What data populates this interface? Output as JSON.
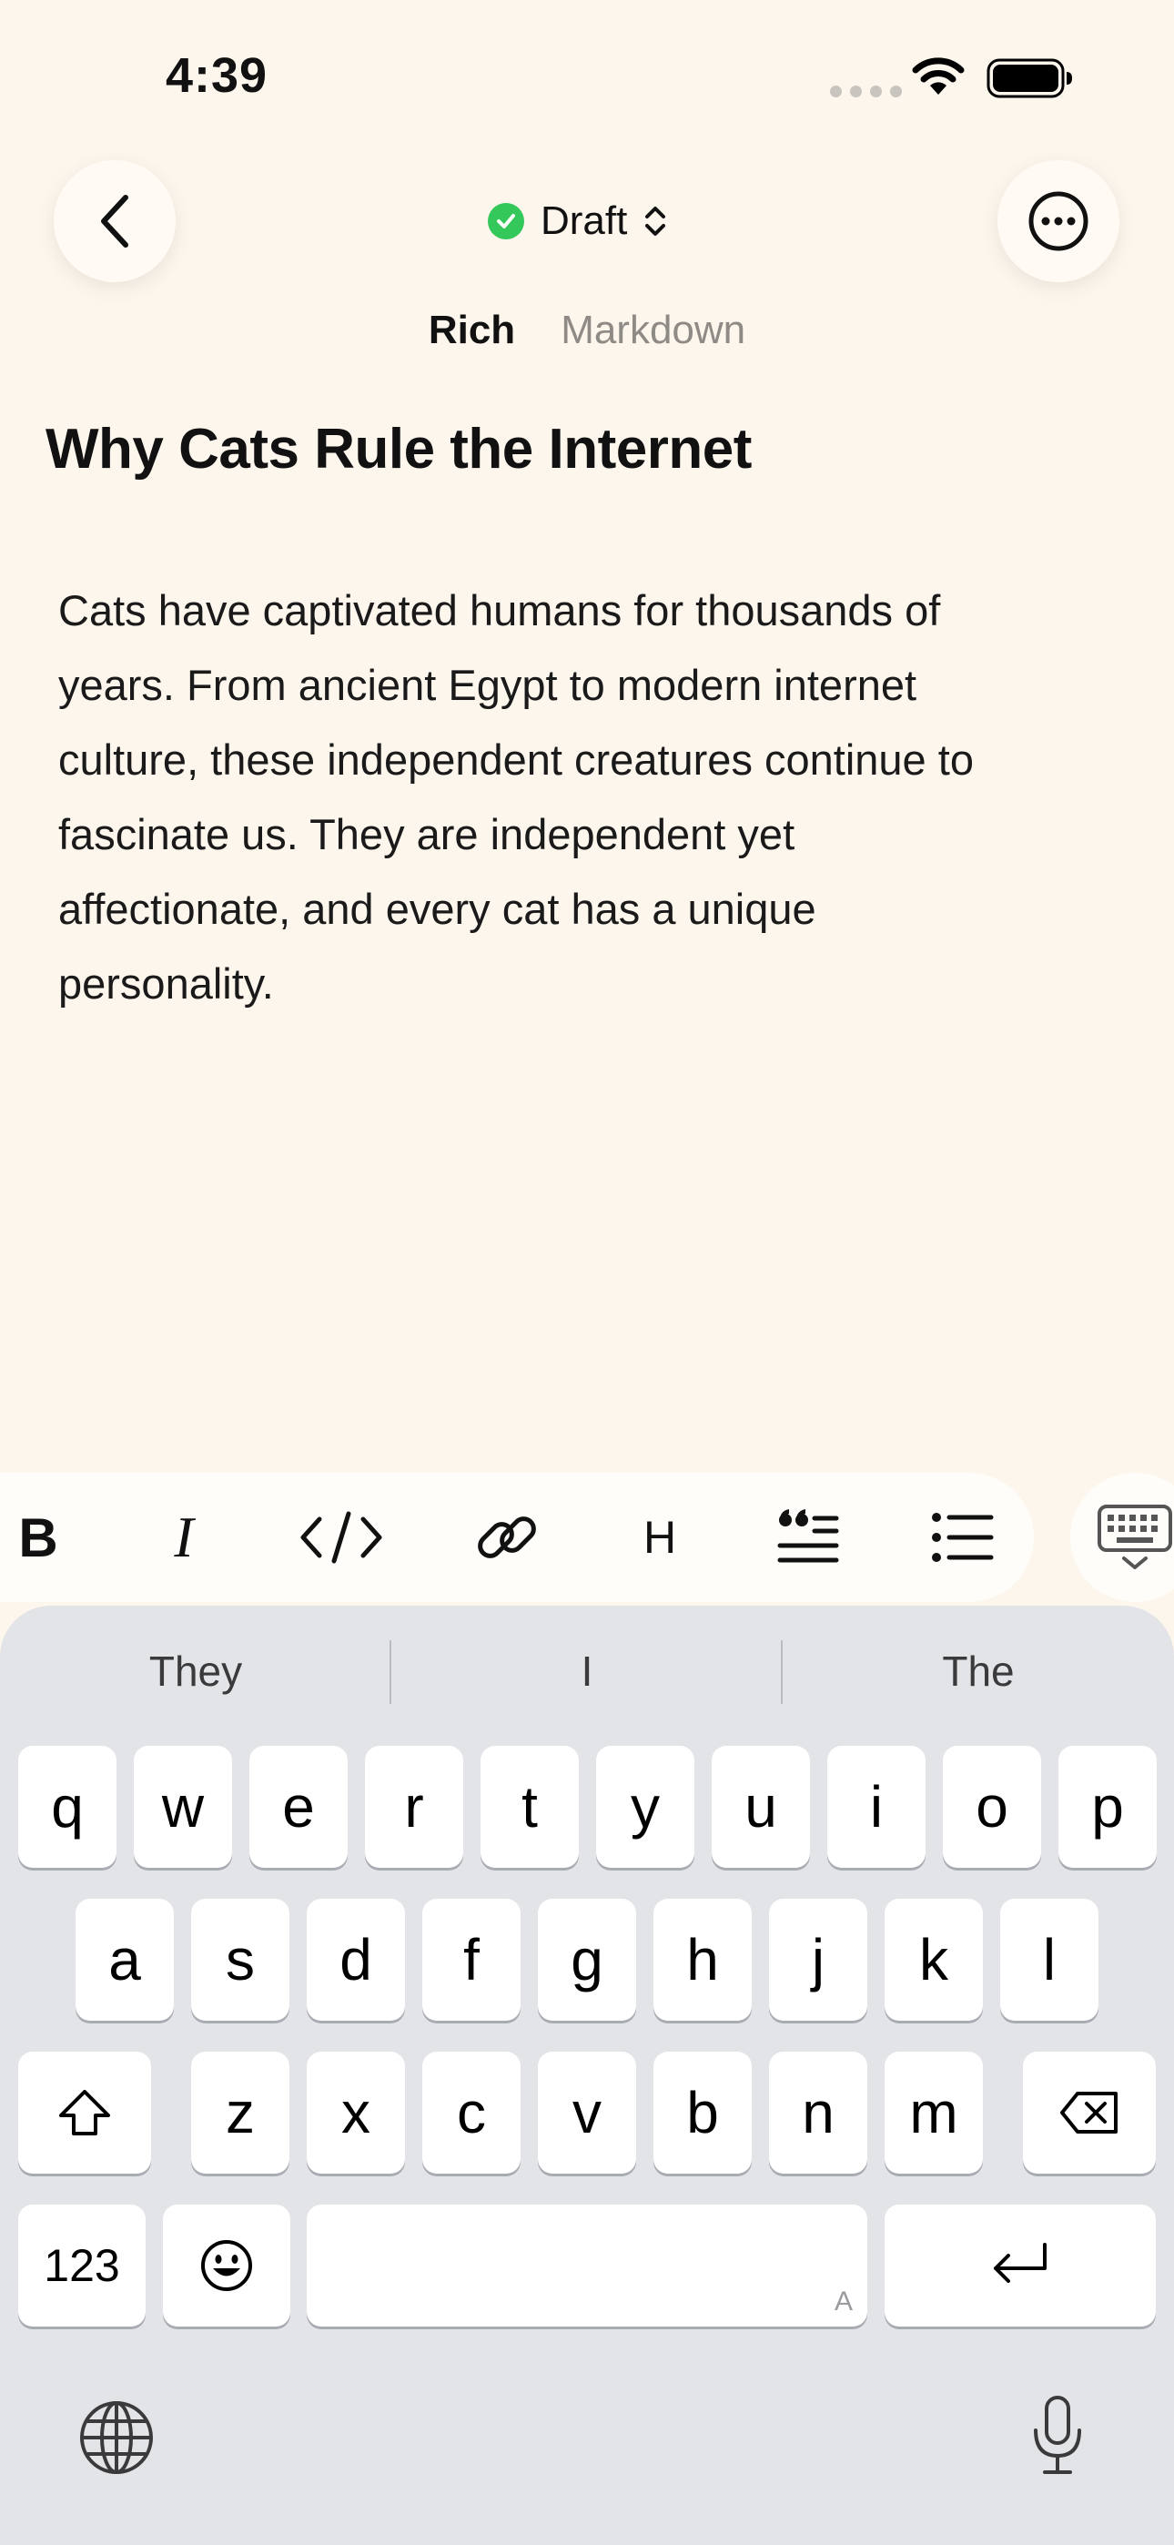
{
  "status_bar": {
    "time": "4:39"
  },
  "header": {
    "status_label": "Draft",
    "tabs": [
      {
        "label": "Rich",
        "active": true
      },
      {
        "label": "Markdown",
        "active": false
      }
    ]
  },
  "document": {
    "title": "Why Cats Rule the Internet",
    "body_lines": [
      "Cats have captivated humans for thousands of",
      "years. From ancient Egypt to modern internet",
      "culture, these independent creatures continue to",
      "fascinate us. They are independent yet",
      "affectionate, and every cat has a unique",
      "personality."
    ]
  },
  "toolbar": {
    "bold": "B",
    "italic": "I",
    "heading": "H",
    "icons": [
      "bold-icon",
      "italic-icon",
      "code-icon",
      "link-icon",
      "heading-icon",
      "quote-icon",
      "list-icon",
      "keyboard-dismiss-icon"
    ]
  },
  "keyboard": {
    "suggestions": [
      "They",
      "I",
      "The"
    ],
    "row1": [
      "q",
      "w",
      "e",
      "r",
      "t",
      "y",
      "u",
      "i",
      "o",
      "p"
    ],
    "row2": [
      "a",
      "s",
      "d",
      "f",
      "g",
      "h",
      "j",
      "k",
      "l"
    ],
    "row3": [
      "z",
      "x",
      "c",
      "v",
      "b",
      "n",
      "m"
    ],
    "numbers_key": "123",
    "space_hint": "A"
  },
  "colors": {
    "background": "#fdf6ed",
    "status_green": "#34c759",
    "keyboard_bg": "#e3e4e8"
  }
}
